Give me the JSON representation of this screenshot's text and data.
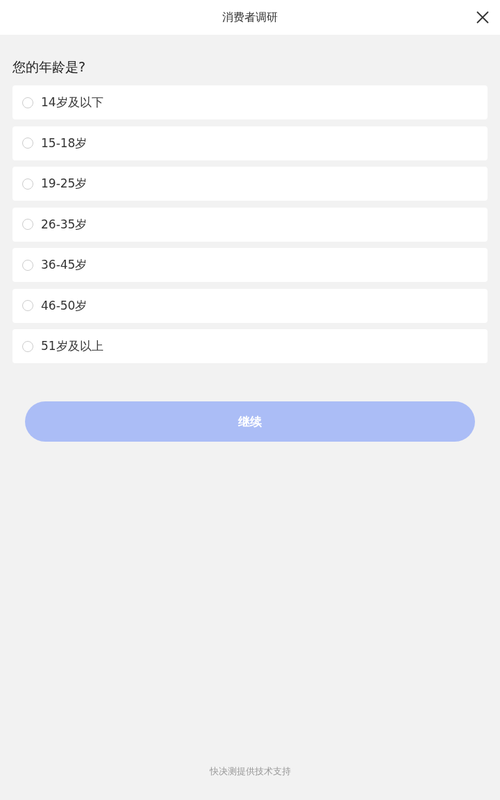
{
  "window": {
    "title": "消费者调研"
  },
  "question": "您的年龄是?",
  "options": [
    {
      "label": "14岁及以下",
      "selected": false
    },
    {
      "label": "15-18岁",
      "selected": false
    },
    {
      "label": "19-25岁",
      "selected": false
    },
    {
      "label": "26-35岁",
      "selected": false
    },
    {
      "label": "36-45岁",
      "selected": false
    },
    {
      "label": "46-50岁",
      "selected": false
    },
    {
      "label": "51岁及以上",
      "selected": false
    }
  ],
  "continue_button": {
    "label": "继续",
    "disabled": true
  },
  "footer": "快决测提供技术支持"
}
